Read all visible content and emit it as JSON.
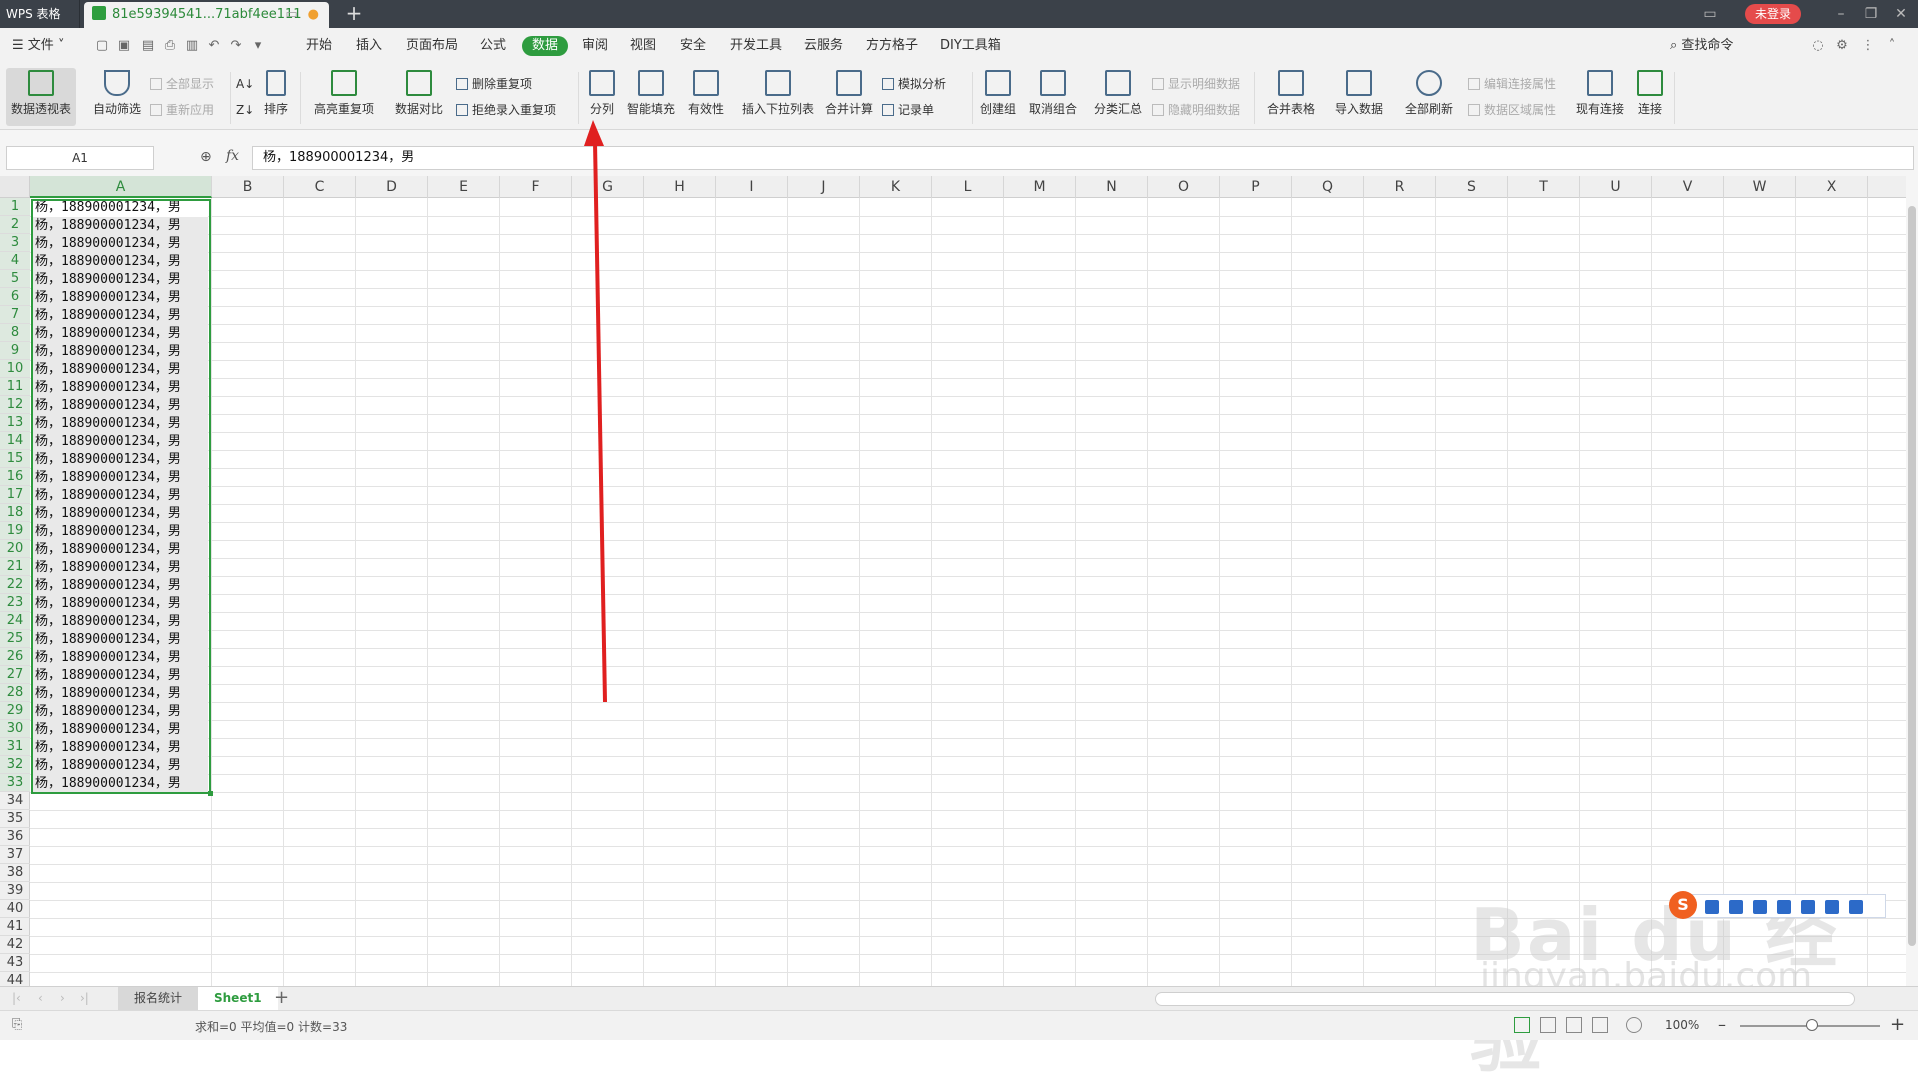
{
  "titlebar": {
    "app_label": "WPS 表格",
    "doc_tab_label": "81e59394541...71abf4ee111",
    "new_tab": "+",
    "login_label": "未登录"
  },
  "menu": {
    "file_label": "文件",
    "items": [
      "开始",
      "插入",
      "页面布局",
      "公式",
      "数据",
      "审阅",
      "视图",
      "安全",
      "开发工具",
      "云服务",
      "方方格子",
      "DIY工具箱"
    ],
    "active": "数据",
    "search_label": "查找命令"
  },
  "ribbon": {
    "pivot": "数据透视表",
    "autofilter": "自动筛选",
    "show_all": "全部显示",
    "reapply": "重新应用",
    "sort": "排序",
    "highlight_dup": "高亮重复项",
    "data_compare": "数据对比",
    "remove_dup": "删除重复项",
    "reject_dup": "拒绝录入重复项",
    "split_col": "分列",
    "smart_fill": "智能填充",
    "validity": "有效性",
    "insert_dropdown": "插入下拉列表",
    "consolidate": "合并计算",
    "what_if": "模拟分析",
    "record_form": "记录单",
    "create_group": "创建组",
    "ungroup": "取消组合",
    "subtotal": "分类汇总",
    "show_detail": "显示明细数据",
    "hide_detail": "隐藏明细数据",
    "merge_tables": "合并表格",
    "import_data": "导入数据",
    "refresh_all": "全部刷新",
    "edit_conn": "编辑连接属性",
    "data_range": "数据区域属性",
    "existing_conn": "现有连接",
    "connect": "连接"
  },
  "formula_bar": {
    "cell_ref": "A1",
    "fx": "fx",
    "content": "杨，188900001234，男"
  },
  "grid": {
    "columns": [
      "A",
      "B",
      "C",
      "D",
      "E",
      "F",
      "G",
      "H",
      "I",
      "J",
      "K",
      "L",
      "M",
      "N",
      "O",
      "P",
      "Q",
      "R",
      "S",
      "T",
      "U",
      "V",
      "W",
      "X"
    ],
    "row_numbers": [
      "1",
      "2",
      "3",
      "4",
      "5",
      "6",
      "7",
      "8",
      "9",
      "10",
      "11",
      "12",
      "13",
      "14",
      "15",
      "16",
      "17",
      "18",
      "19",
      "20",
      "21",
      "22",
      "23",
      "24",
      "25",
      "26",
      "27",
      "28",
      "29",
      "30",
      "31",
      "32",
      "33",
      "34",
      "35",
      "36",
      "37",
      "38",
      "39",
      "40",
      "41",
      "42",
      "43",
      "44"
    ],
    "selected_rows": 33,
    "col_a_values": [
      "杨，188900001234，男",
      "杨，188900001234，男",
      "杨，188900001234，男",
      "杨，188900001234，男",
      "杨，188900001234，男",
      "杨，188900001234，男",
      "杨，188900001234，男",
      "杨，188900001234，男",
      "杨，188900001234，男",
      "杨，188900001234，男",
      "杨，188900001234，男",
      "杨，188900001234，男",
      "杨，188900001234，男",
      "杨，188900001234，男",
      "杨，188900001234，男",
      "杨，188900001234，男",
      "杨，188900001234，男",
      "杨，188900001234，男",
      "杨，188900001234，男",
      "杨，188900001234，男",
      "杨，188900001234，男",
      "杨，188900001234，男",
      "杨，188900001234，男",
      "杨，188900001234，男",
      "杨，188900001234，男",
      "杨，188900001234，男",
      "杨，188900001234，男",
      "杨，188900001234，男",
      "杨，188900001234，男",
      "杨，188900001234，男",
      "杨，188900001234，男",
      "杨，188900001234，男",
      "杨，188900001234，男"
    ]
  },
  "sheets": {
    "tabs": [
      "报名统计",
      "Sheet1"
    ],
    "active": "Sheet1"
  },
  "status": {
    "summary": "求和=0  平均值=0  计数=33",
    "zoom": "100%"
  },
  "watermark": {
    "text": "Bai du 经验",
    "url": "jingyan.baidu.com"
  },
  "colors": {
    "accent": "#2e9c3f",
    "arrow": "#e02020",
    "titlebar": "#3b4149",
    "login": "#e54b4b"
  }
}
